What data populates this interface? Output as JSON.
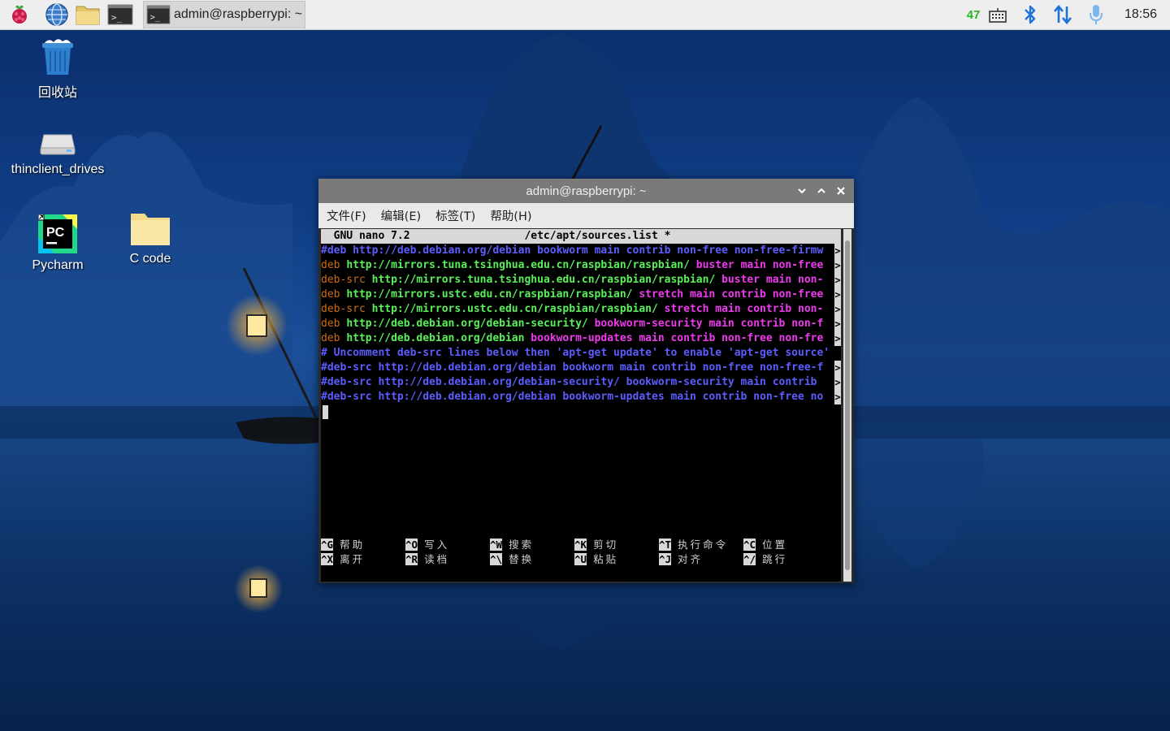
{
  "taskbar": {
    "active_task_label": "admin@raspberrypi: ~",
    "cpu_usage": "47",
    "clock": "18:56",
    "icons": [
      "raspberry-menu-icon",
      "web-browser-icon",
      "file-manager-icon",
      "terminal-icon",
      "keyboard-icon",
      "bluetooth-icon",
      "network-icon",
      "microphone-icon"
    ]
  },
  "desktop": {
    "icons": [
      {
        "label": "回收站",
        "icon": "trash-icon"
      },
      {
        "label": "thinclient_drives",
        "icon": "drive-icon"
      },
      {
        "label": "Pycharm",
        "icon": "pycharm-icon"
      },
      {
        "label": "C code",
        "icon": "folder-icon"
      }
    ]
  },
  "window": {
    "title": "admin@raspberrypi: ~",
    "menu": [
      "文件(F)",
      "编辑(E)",
      "标签(T)",
      "帮助(H)"
    ]
  },
  "nano": {
    "header": "  GNU nano 7.2                  /etc/apt/sources.list *",
    "lines": [
      {
        "parts": [
          {
            "t": "#deb http://deb.debian.org/debian bookworm main contrib non-free non-free-firmw",
            "c": "c-comment"
          }
        ],
        "overflow": true
      },
      {
        "parts": [
          {
            "t": "deb ",
            "c": "c-deb"
          },
          {
            "t": "http://mirrors.tuna.tsinghua.edu.cn/raspbian/raspbian/ ",
            "c": "c-url"
          },
          {
            "t": "buster main non-free",
            "c": "c-rest"
          }
        ],
        "overflow": true
      },
      {
        "parts": [
          {
            "t": "deb-src ",
            "c": "c-deb"
          },
          {
            "t": "http://mirrors.tuna.tsinghua.edu.cn/raspbian/raspbian/ ",
            "c": "c-url"
          },
          {
            "t": "buster main non-",
            "c": "c-rest"
          }
        ],
        "overflow": true
      },
      {
        "parts": [
          {
            "t": "deb ",
            "c": "c-deb"
          },
          {
            "t": "http://mirrors.ustc.edu.cn/raspbian/raspbian/ ",
            "c": "c-url"
          },
          {
            "t": "stretch main contrib non-free",
            "c": "c-rest"
          }
        ],
        "overflow": true
      },
      {
        "parts": [
          {
            "t": "deb-src ",
            "c": "c-deb"
          },
          {
            "t": "http://mirrors.ustc.edu.cn/raspbian/raspbian/ ",
            "c": "c-url"
          },
          {
            "t": "stretch main contrib non-",
            "c": "c-rest"
          }
        ],
        "overflow": true
      },
      {
        "parts": [
          {
            "t": "deb ",
            "c": "c-deb"
          },
          {
            "t": "http://deb.debian.org/debian-security/ ",
            "c": "c-url"
          },
          {
            "t": "bookworm-security main contrib non-f",
            "c": "c-rest"
          }
        ],
        "overflow": true
      },
      {
        "parts": [
          {
            "t": "deb ",
            "c": "c-deb"
          },
          {
            "t": "http://deb.debian.org/debian ",
            "c": "c-url"
          },
          {
            "t": "bookworm-updates main contrib non-free non-fre",
            "c": "c-rest"
          }
        ],
        "overflow": true
      },
      {
        "parts": [
          {
            "t": "# Uncomment deb-src lines below then 'apt-get update' to enable 'apt-get source'",
            "c": "c-comment"
          }
        ],
        "overflow": false
      },
      {
        "parts": [
          {
            "t": "#deb-src http://deb.debian.org/debian bookworm main contrib non-free non-free-f",
            "c": "c-comment"
          }
        ],
        "overflow": true
      },
      {
        "parts": [
          {
            "t": "#deb-src http://deb.debian.org/debian-security/ bookworm-security main contrib ",
            "c": "c-comment"
          }
        ],
        "overflow": true
      },
      {
        "parts": [
          {
            "t": "#deb-src http://deb.debian.org/debian bookworm-updates main contrib non-free no",
            "c": "c-comment"
          }
        ],
        "overflow": true
      }
    ],
    "overflow_marker": ">",
    "shortcuts_row1": [
      {
        "key": "^G",
        "label": "帮助"
      },
      {
        "key": "^O",
        "label": "写入"
      },
      {
        "key": "^W",
        "label": "搜索"
      },
      {
        "key": "^K",
        "label": "剪切"
      },
      {
        "key": "^T",
        "label": "执行命令"
      },
      {
        "key": "^C",
        "label": "位置"
      }
    ],
    "shortcuts_row2": [
      {
        "key": "^X",
        "label": "离开"
      },
      {
        "key": "^R",
        "label": "读档"
      },
      {
        "key": "^\\",
        "label": "替换"
      },
      {
        "key": "^U",
        "label": "粘贴"
      },
      {
        "key": "^J",
        "label": "对齐"
      },
      {
        "key": "^/",
        "label": "跳行"
      }
    ]
  }
}
